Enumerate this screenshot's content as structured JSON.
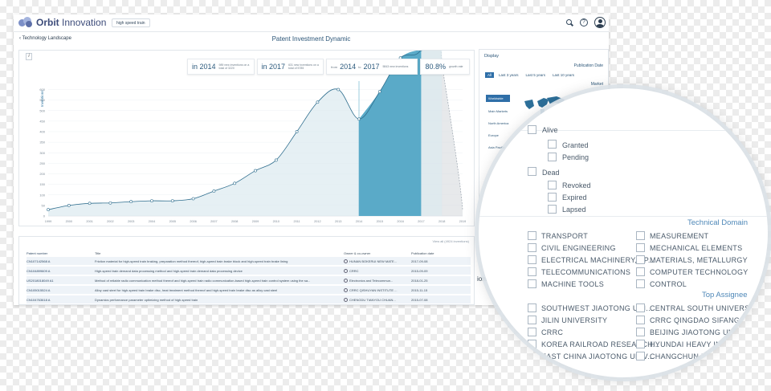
{
  "app": {
    "logo_word1": "Orbit",
    "logo_word2": "Innovation",
    "search_query": "high speed train",
    "help_icon": "help-icon",
    "user_icon": "user-icon",
    "search_icon": "search-icon"
  },
  "nav": {
    "back_label": "Technology Landscape",
    "page_title": "Patent Investment Dynamic"
  },
  "stats": {
    "s1_year": "in 2014",
    "s1_desc": "989 new inventions on a total of 3220",
    "s2_year": "in 2017",
    "s2_desc": "631 new inventions on a total of 5785",
    "s3_from": "from",
    "s3_year_from": "2014",
    "s3_to": "to",
    "s3_year_to": "2017",
    "s3_desc": "5843 new inventions",
    "s4_value": "80.8%",
    "s4_desc": "growth rate"
  },
  "chart_data": {
    "type": "area",
    "ylabel": "Inventions",
    "x": [
      "1999",
      "2000",
      "2001",
      "2002",
      "2003",
      "2004",
      "2005",
      "2006",
      "2007",
      "2008",
      "2009",
      "2010",
      "2011",
      "2012",
      "2013",
      "2014",
      "2015",
      "2016",
      "2017",
      "2018",
      "2019"
    ],
    "values": [
      30,
      50,
      60,
      62,
      68,
      72,
      72,
      82,
      118,
      155,
      215,
      265,
      400,
      540,
      600,
      460,
      590,
      750,
      790,
      1060,
      null
    ],
    "projection": [
      [
        2017,
        1060
      ],
      [
        2018,
        720
      ],
      [
        2019,
        30
      ]
    ],
    "highlight_range": [
      "2014",
      "2017"
    ],
    "yticks": [
      0,
      50,
      100,
      150,
      200,
      250,
      300,
      350,
      400,
      450,
      500,
      550,
      600
    ],
    "ylim": [
      0,
      640
    ],
    "colors": {
      "line": "#2f6e8e",
      "area": "#dbe9f0",
      "highlight": "#5aaac8",
      "projection": "#d7dade"
    }
  },
  "table": {
    "view_all": "View all (4924 inventions)",
    "headers": [
      "Patent number",
      "Title",
      "Owner & co-owner",
      "Publication date"
    ],
    "rows": [
      {
        "num": "CN107142568 A",
        "title": "Friction material for high-speed train braking, preparation method thereof, high-speed train brake block and high-speed train brake lining",
        "owner": "HUNAN BOKERUI NEW MATE...",
        "date": "2017-09-08"
      },
      {
        "num": "CN104899609 A",
        "title": "High-speed train demand data processing method and high-speed train demand data processing device",
        "owner": "CRRC",
        "date": "2015-09-09"
      },
      {
        "num": "US2018018049 A1",
        "title": "Method of reliable radio communication method thereof and high-speed train radio communication-based high-speed train control system using the sa...",
        "owner": "Electronics and Telecommun...",
        "date": "2018-01-25"
      },
      {
        "num": "CN105015524 A",
        "title": "Alloy cast steel for high-speed train brake disc, heat treatment method thereof and high-speed train brake disc as alloy cast steel",
        "owner": "CRRC QISHUYAN INSTITUTE ...",
        "date": "2015-11-15"
      },
      {
        "num": "CN104763618 A",
        "title": "Dynamics performance parameter optimizing method of high-speed train",
        "owner": "CHENGDU TIANYOU CHUAN...",
        "date": "2015-07-08"
      }
    ]
  },
  "display": {
    "title": "Display",
    "pub_date": "Publication Date",
    "pills": [
      "All",
      "Last 3 years",
      "Last 5 years",
      "Last 10 years"
    ],
    "market": "Market",
    "regions": [
      "Worldwide",
      "Main Markets",
      "North America",
      "Europe",
      "Asia Pacific"
    ]
  },
  "under_panel": {
    "frag1": "ions)",
    "frag2": "s",
    "frag3": "a"
  },
  "magnifier": {
    "status": {
      "alive": "Alive",
      "granted": "Granted",
      "pending": "Pending",
      "dead": "Dead",
      "revoked": "Revoked",
      "expired": "Expired",
      "lapsed": "Lapsed"
    },
    "technical_domain_title": "Technical Domain",
    "technical_left": [
      "TRANSPORT",
      "CIVIL ENGINEERING",
      "ELECTRICAL MACHINERY, AP...",
      "TELECOMMUNICATIONS",
      "MACHINE TOOLS"
    ],
    "technical_right": [
      "MEASUREMENT",
      "MECHANICAL ELEMENTS",
      "MATERIALS, METALLURGY",
      "COMPUTER TECHNOLOGY",
      "CONTROL"
    ],
    "top_assignee_title": "Top Assignee",
    "assignee_left": [
      "SOUTHWEST JIAOTONG UNI...",
      "JILIN UNIVERSITY",
      "CRRC",
      "KOREA RAILROAD RESEARCH...",
      "EAST CHINA JIAOTONG UNIV..."
    ],
    "assignee_right": [
      "CENTRAL SOUTH UNIVERSITY",
      "CRRC QINGDAO SIFANG",
      "BEIJING JIAOTONG UNIVE...",
      "HYUNDAI HEAVY INDU...",
      "CHANGCHUN RAIL..."
    ]
  }
}
